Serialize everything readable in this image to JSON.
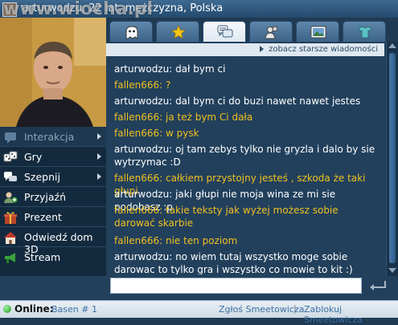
{
  "window": {
    "title": "arturwodzu, 22 lat, mężczyzna, Polska",
    "watermark": "www.wiocha.pl"
  },
  "tabs": [
    {
      "icon": "ghost-icon",
      "active": false
    },
    {
      "icon": "star-icon",
      "active": false
    },
    {
      "icon": "chat-bubbles-icon",
      "active": true
    },
    {
      "icon": "friends-icon",
      "active": false
    },
    {
      "icon": "photos-icon",
      "active": false
    },
    {
      "icon": "tshirt-icon",
      "active": false
    }
  ],
  "sidebar": {
    "header": "Interakcja",
    "items": [
      {
        "label": "Gry",
        "icon": "dice-icon",
        "submenu": true
      },
      {
        "label": "Szepnij",
        "icon": "whisper-icon",
        "submenu": true
      },
      {
        "label": "Przyjaźń",
        "icon": "add-friend-icon",
        "submenu": false
      },
      {
        "label": "Prezent",
        "icon": "gift-icon",
        "submenu": false
      },
      {
        "label": "Odwiedź dom 3D",
        "icon": "house-icon",
        "submenu": false
      },
      {
        "label": "Stream",
        "icon": "megaphone-icon",
        "submenu": false
      }
    ]
  },
  "chat": {
    "older_link": "zobacz starsze wiadomości",
    "messages": [
      {
        "author": "arturwodzu",
        "text": "arturwodzu: dał bym ci",
        "who": "me"
      },
      {
        "author": "fallen666",
        "text": "fallen666: ?",
        "who": "them"
      },
      {
        "author": "arturwodzu",
        "text": "arturwodzu: dal bym ci do buzi nawet nawet jestes",
        "who": "me"
      },
      {
        "author": "fallen666",
        "text": "fallen666: ja też bym Ci dała",
        "who": "them"
      },
      {
        "author": "fallen666",
        "text": "fallen666: w pysk",
        "who": "them"
      },
      {
        "author": "arturwodzu",
        "text": "arturwodzu: oj tam zebys tylko nie gryzla i dalo by sie wytrzymac :D",
        "who": "me"
      },
      {
        "author": "fallen666",
        "text": "fallen666: całkiem przystojny jesteś , szkoda że taki głupi",
        "who": "them"
      },
      {
        "author": "arturwodzu",
        "text": "arturwodzu: jaki głupi nie moja wina ze mi sie podobasz :p",
        "who": "me"
      },
      {
        "author": "fallen666",
        "text": "fallen666: takie teksty jak wyżej możesz sobie darować skarbie",
        "who": "them"
      },
      {
        "author": "fallen666",
        "text": "fallen666: nie ten poziom",
        "who": "them"
      },
      {
        "author": "arturwodzu",
        "text": "arturwodzu: no wiem tutaj wszystko moge sobie darowac to tylko gra i wszystko co mowie to kit :)",
        "who": "me"
      }
    ],
    "input_value": ""
  },
  "status": {
    "label": "Online:",
    "room": "Basen # 1",
    "report": "Zgłoś Smeetowicza",
    "separator": "|",
    "block": "Zablokuj Smeetowicza"
  },
  "colors": {
    "my_message": "#ffffff",
    "their_message": "#f0c020",
    "panel_bg": "#22405c",
    "online": "#1a9a1a"
  }
}
